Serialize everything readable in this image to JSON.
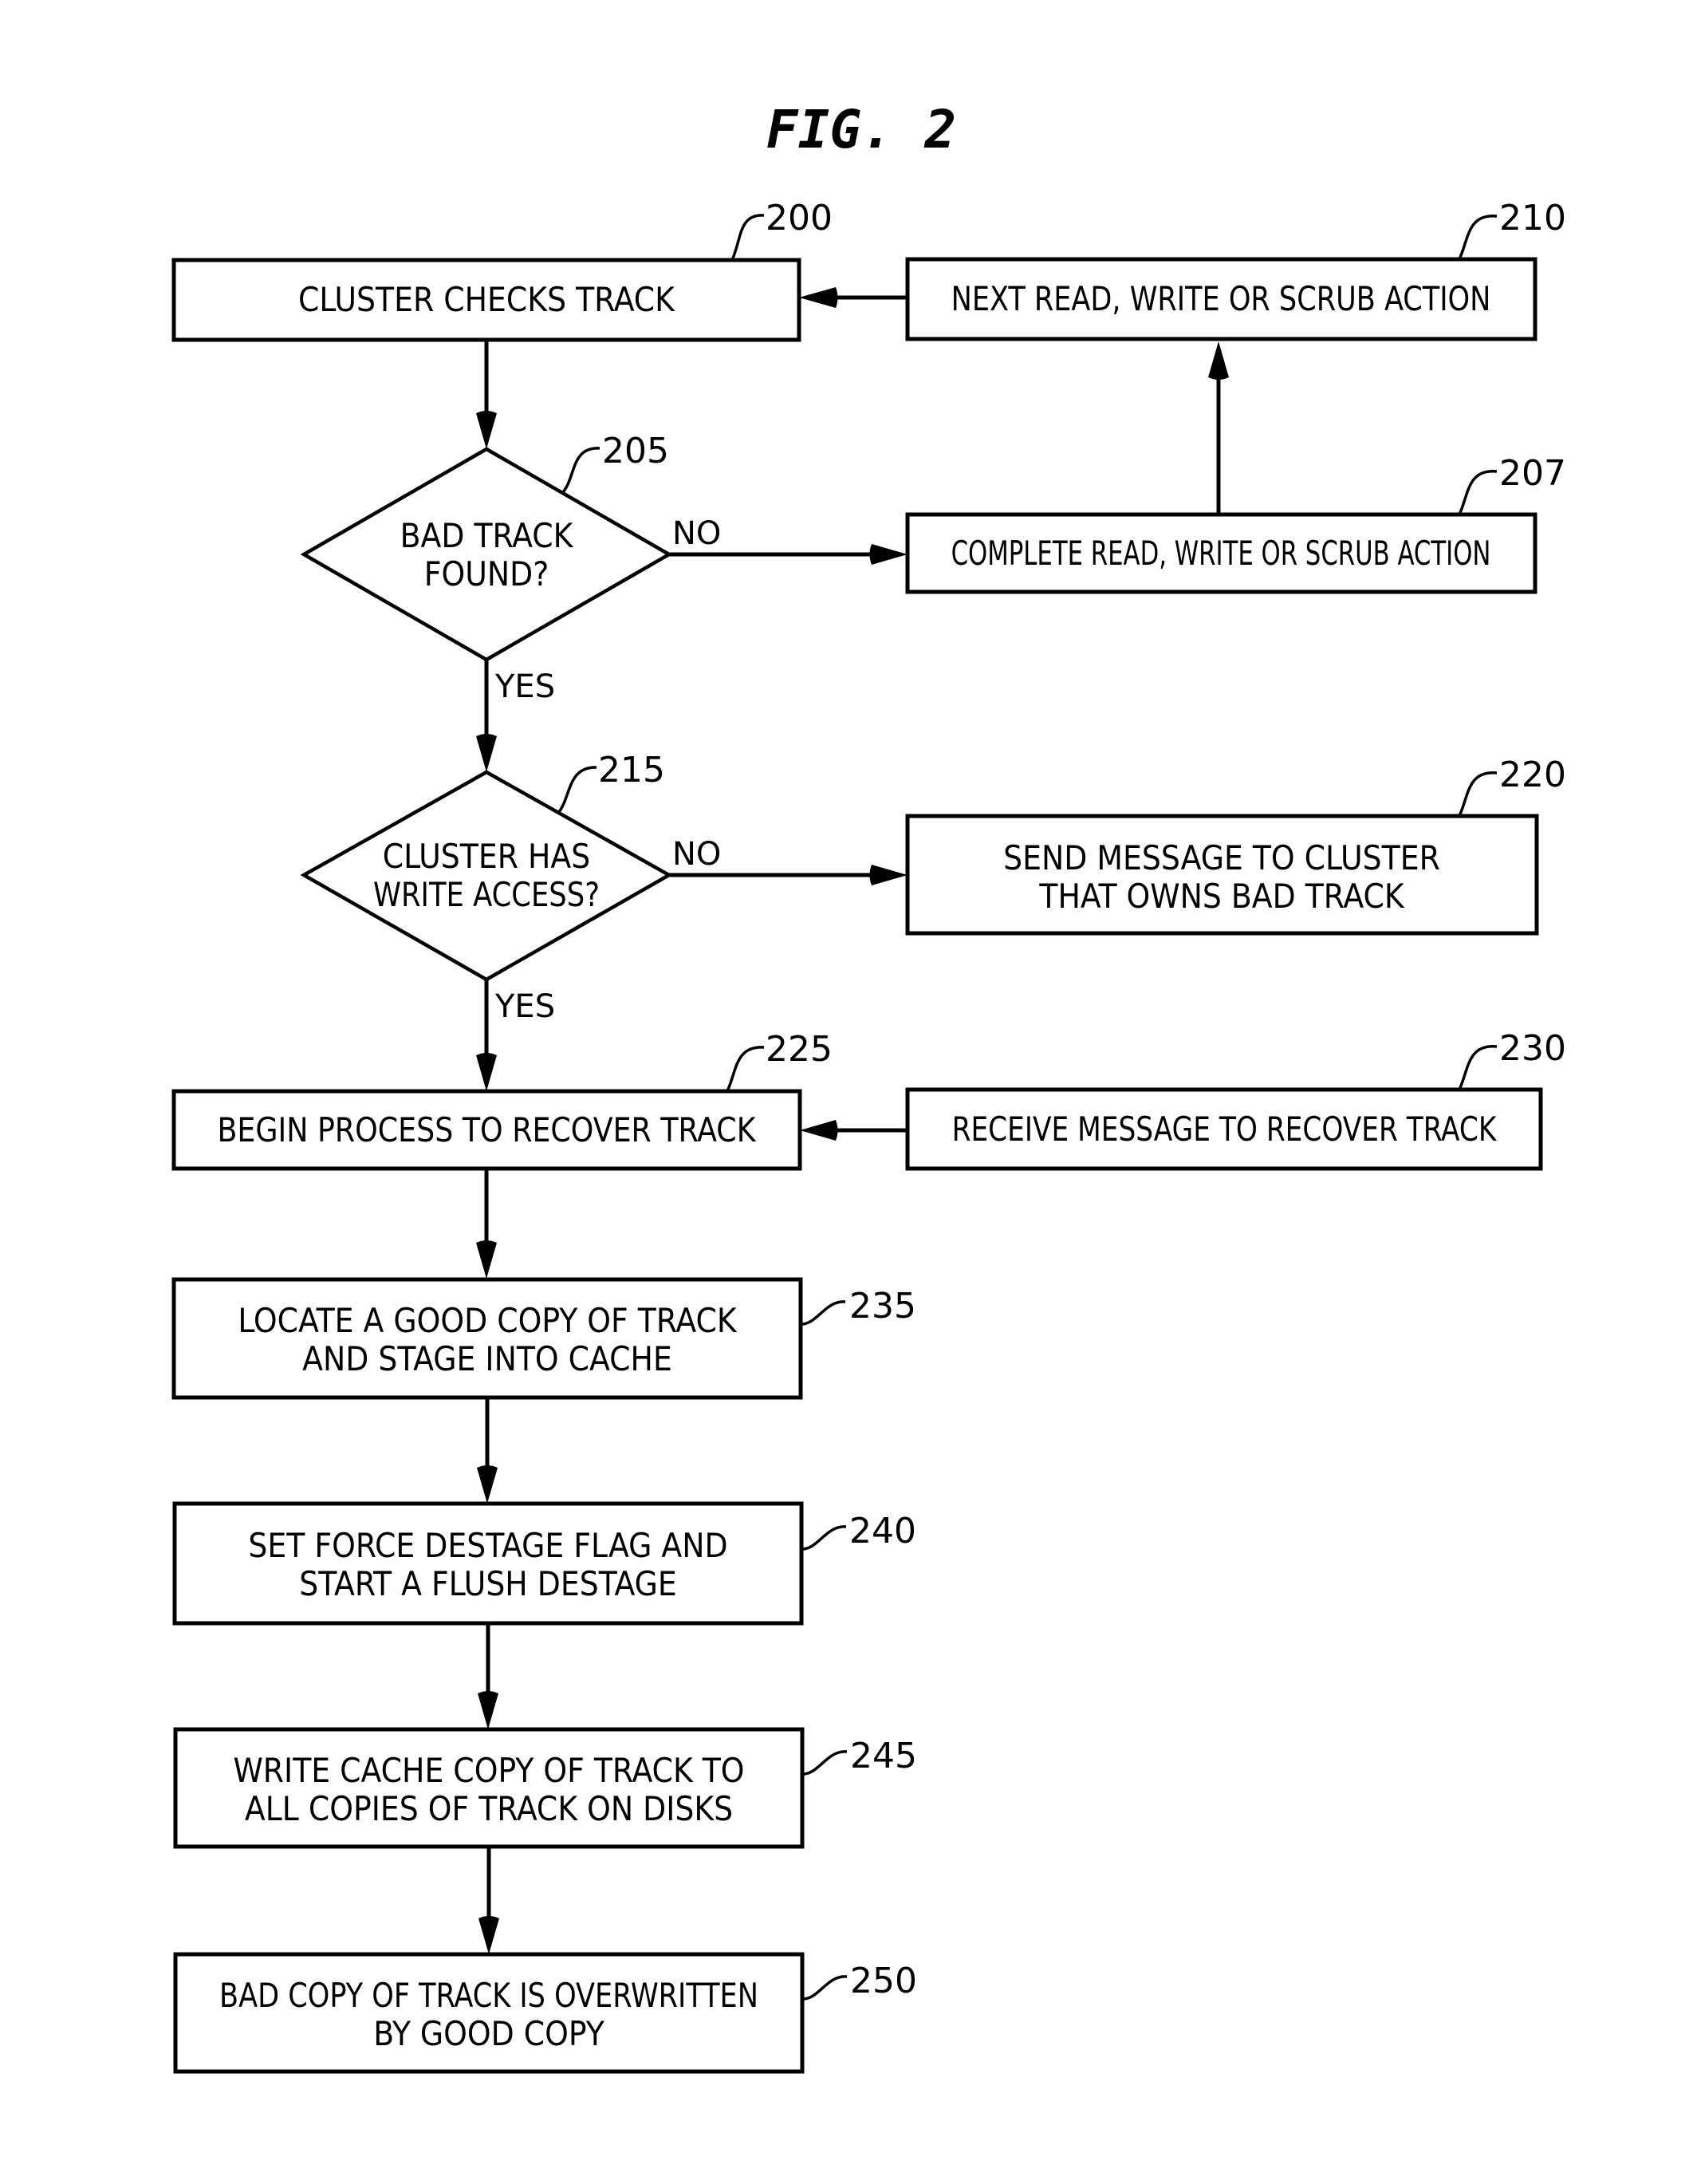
{
  "figure": {
    "title": "FIG. 2"
  },
  "nodes": {
    "n200": {
      "ref": "200",
      "shape": "process",
      "lines": [
        "CLUSTER CHECKS TRACK"
      ]
    },
    "n205": {
      "ref": "205",
      "shape": "decision",
      "lines": [
        "BAD TRACK",
        "FOUND?"
      ]
    },
    "n207": {
      "ref": "207",
      "shape": "process",
      "lines": [
        "COMPLETE READ, WRITE OR SCRUB ACTION"
      ]
    },
    "n210": {
      "ref": "210",
      "shape": "process",
      "lines": [
        "NEXT READ, WRITE OR SCRUB ACTION"
      ]
    },
    "n215": {
      "ref": "215",
      "shape": "decision",
      "lines": [
        "CLUSTER HAS",
        "WRITE ACCESS?"
      ]
    },
    "n220": {
      "ref": "220",
      "shape": "process",
      "lines": [
        "SEND MESSAGE TO CLUSTER",
        "THAT OWNS BAD TRACK"
      ]
    },
    "n225": {
      "ref": "225",
      "shape": "process",
      "lines": [
        "BEGIN PROCESS TO RECOVER TRACK"
      ]
    },
    "n230": {
      "ref": "230",
      "shape": "process",
      "lines": [
        "RECEIVE MESSAGE TO RECOVER TRACK"
      ]
    },
    "n235": {
      "ref": "235",
      "shape": "process",
      "lines": [
        "LOCATE A GOOD COPY OF TRACK",
        "AND STAGE INTO CACHE"
      ]
    },
    "n240": {
      "ref": "240",
      "shape": "process",
      "lines": [
        "SET FORCE DESTAGE FLAG AND",
        "START A FLUSH DESTAGE"
      ]
    },
    "n245": {
      "ref": "245",
      "shape": "process",
      "lines": [
        "WRITE CACHE COPY OF TRACK TO",
        "ALL COPIES OF TRACK ON DISKS"
      ]
    },
    "n250": {
      "ref": "250",
      "shape": "process",
      "lines": [
        "BAD COPY OF TRACK IS OVERWRITTEN",
        "BY GOOD COPY"
      ]
    }
  },
  "edges": [
    {
      "from": "200",
      "to": "205",
      "label": ""
    },
    {
      "from": "205",
      "to": "207",
      "label": "NO"
    },
    {
      "from": "205",
      "to": "215",
      "label": "YES"
    },
    {
      "from": "207",
      "to": "210",
      "label": ""
    },
    {
      "from": "210",
      "to": "200",
      "label": ""
    },
    {
      "from": "215",
      "to": "220",
      "label": "NO"
    },
    {
      "from": "215",
      "to": "225",
      "label": "YES"
    },
    {
      "from": "230",
      "to": "225",
      "label": ""
    },
    {
      "from": "225",
      "to": "235",
      "label": ""
    },
    {
      "from": "235",
      "to": "240",
      "label": ""
    },
    {
      "from": "240",
      "to": "245",
      "label": ""
    },
    {
      "from": "245",
      "to": "250",
      "label": ""
    }
  ],
  "labels": {
    "no_205": "NO",
    "yes_205": "YES",
    "no_215": "NO",
    "yes_215": "YES"
  }
}
